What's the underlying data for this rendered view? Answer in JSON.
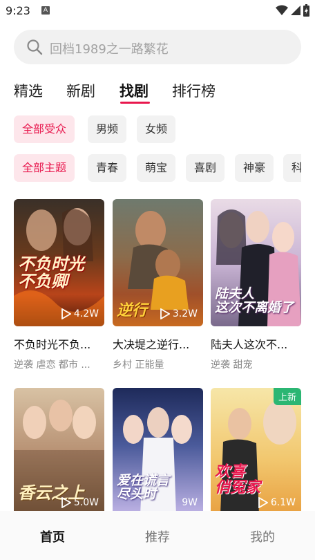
{
  "status_bar": {
    "time": "9:23",
    "notification_letter": "A"
  },
  "search": {
    "placeholder": "回档1989之一路繁花"
  },
  "tabs": [
    {
      "label": "精选"
    },
    {
      "label": "新剧"
    },
    {
      "label": "找剧",
      "active": true
    },
    {
      "label": "排行榜"
    }
  ],
  "audience_filters": [
    {
      "label": "全部受众",
      "active": true
    },
    {
      "label": "男频"
    },
    {
      "label": "女频"
    }
  ],
  "theme_filters": [
    {
      "label": "全部主题",
      "active": true
    },
    {
      "label": "青春"
    },
    {
      "label": "萌宝"
    },
    {
      "label": "喜剧"
    },
    {
      "label": "神豪"
    },
    {
      "label": "科"
    }
  ],
  "dramas": [
    {
      "cover_text": "不负时光\n不负卿",
      "views": "4.2W",
      "title": "不负时光不负卿",
      "tags": "逆袭 虐恋 都市 ..."
    },
    {
      "cover_text": "逆行",
      "views": "3.2W",
      "title": "大决堤之逆行者",
      "tags": "乡村 正能量"
    },
    {
      "cover_text": "陆夫人\n这次不离婚了",
      "views": "",
      "title": "陆夫人这次不离婚了",
      "tags": "逆袭 甜宠"
    },
    {
      "cover_text": "香云之上",
      "views": "5.0W",
      "title": "",
      "tags": ""
    },
    {
      "cover_text": "爱在谎言\n尽头时",
      "views": "9W",
      "title": "",
      "tags": ""
    },
    {
      "cover_text": "欢喜\n俏冤家",
      "views": "6.1W",
      "badge": "上新",
      "title": "",
      "tags": ""
    }
  ],
  "bottom_nav": [
    {
      "label": "首页",
      "active": true
    },
    {
      "label": "推荐"
    },
    {
      "label": "我的"
    }
  ],
  "colors": {
    "accent": "#e8174d",
    "badge_green": "#2bb673"
  }
}
